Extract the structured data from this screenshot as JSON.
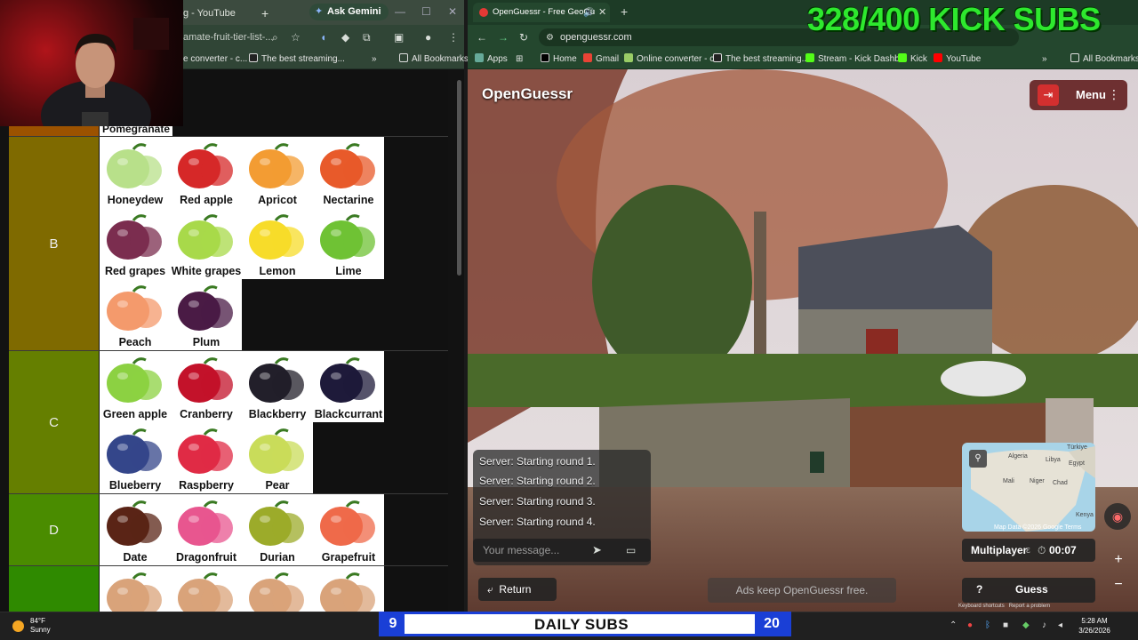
{
  "overlay": {
    "subs_goal": "328/400 KICK SUBS"
  },
  "left_browser": {
    "tabs": [
      {
        "label": "g - YouTube"
      }
    ],
    "gemini_label": "Ask Gemini",
    "url": "amate-fruit-tier-list-...",
    "bookmarks": [
      "e converter - c...",
      "The best streaming...",
      "All Bookmarks"
    ],
    "tier_list": {
      "top_partial_item": "Pomegranate",
      "tiers": [
        {
          "label": "B",
          "color": "#7f6a00",
          "items": [
            "Honeydew",
            "Red apple",
            "Apricot",
            "Nectarine",
            "Red grapes",
            "White grapes",
            "Lemon",
            "Lime",
            "Peach",
            "Plum"
          ]
        },
        {
          "label": "C",
          "color": "#657f00",
          "items": [
            "Green apple",
            "Cranberry",
            "Blackberry",
            "Blackcurrant",
            "Blueberry",
            "Raspberry",
            "Pear"
          ]
        },
        {
          "label": "D",
          "color": "#4a8c00",
          "items": [
            "Date",
            "Dragonfruit",
            "Durian",
            "Grapefruit"
          ]
        },
        {
          "label": "",
          "color": "#2f8a00",
          "items": [
            "",
            "",
            "",
            ""
          ]
        }
      ]
    }
  },
  "right_browser": {
    "tab_title": "OpenGuessr - Free GeoGu",
    "url": "openguessr.com",
    "bookmarks": [
      "Apps",
      "Home",
      "Gmail",
      "Online converter - c...",
      "The best streaming...",
      "Stream - Kick Dashb...",
      "Kick",
      "YouTube",
      "All Bookmarks"
    ],
    "game": {
      "logo": "OpenGuessr",
      "menu_label": "Menu",
      "chat_messages": [
        "Server: Starting round 1.",
        "Server: Starting round 2.",
        "Server: Starting round 3.",
        "Server: Starting round 4."
      ],
      "chat_placeholder": "Your message...",
      "return_label": "Return",
      "ads_text": "Ads keep OpenGuessr free.",
      "mode_label": "Multiplayer",
      "timer": "00:07",
      "guess_label": "Guess",
      "help_label": "?",
      "map_data": "Map Data ©2026 Google",
      "map_terms": "Terms",
      "keyboard_shortcuts": "Keyboard shortcuts",
      "report": "Report a problem",
      "map_labels": [
        "Algeria",
        "Libya",
        "Mali",
        "Niger",
        "Chad",
        "Türkiye",
        "Egypt",
        "Kenya"
      ]
    }
  },
  "taskbar": {
    "weather_temp": "84°F",
    "weather_desc": "Sunny",
    "daily_subs_label": "DAILY SUBS",
    "daily_subs_left": "9",
    "daily_subs_count": "20",
    "time": "5:28 AM",
    "date": "3/26/2026"
  },
  "colors": {
    "kick_green": "#2ee82e",
    "og_red": "#ff3b3b",
    "daily_blue": "#1a3fd6"
  }
}
